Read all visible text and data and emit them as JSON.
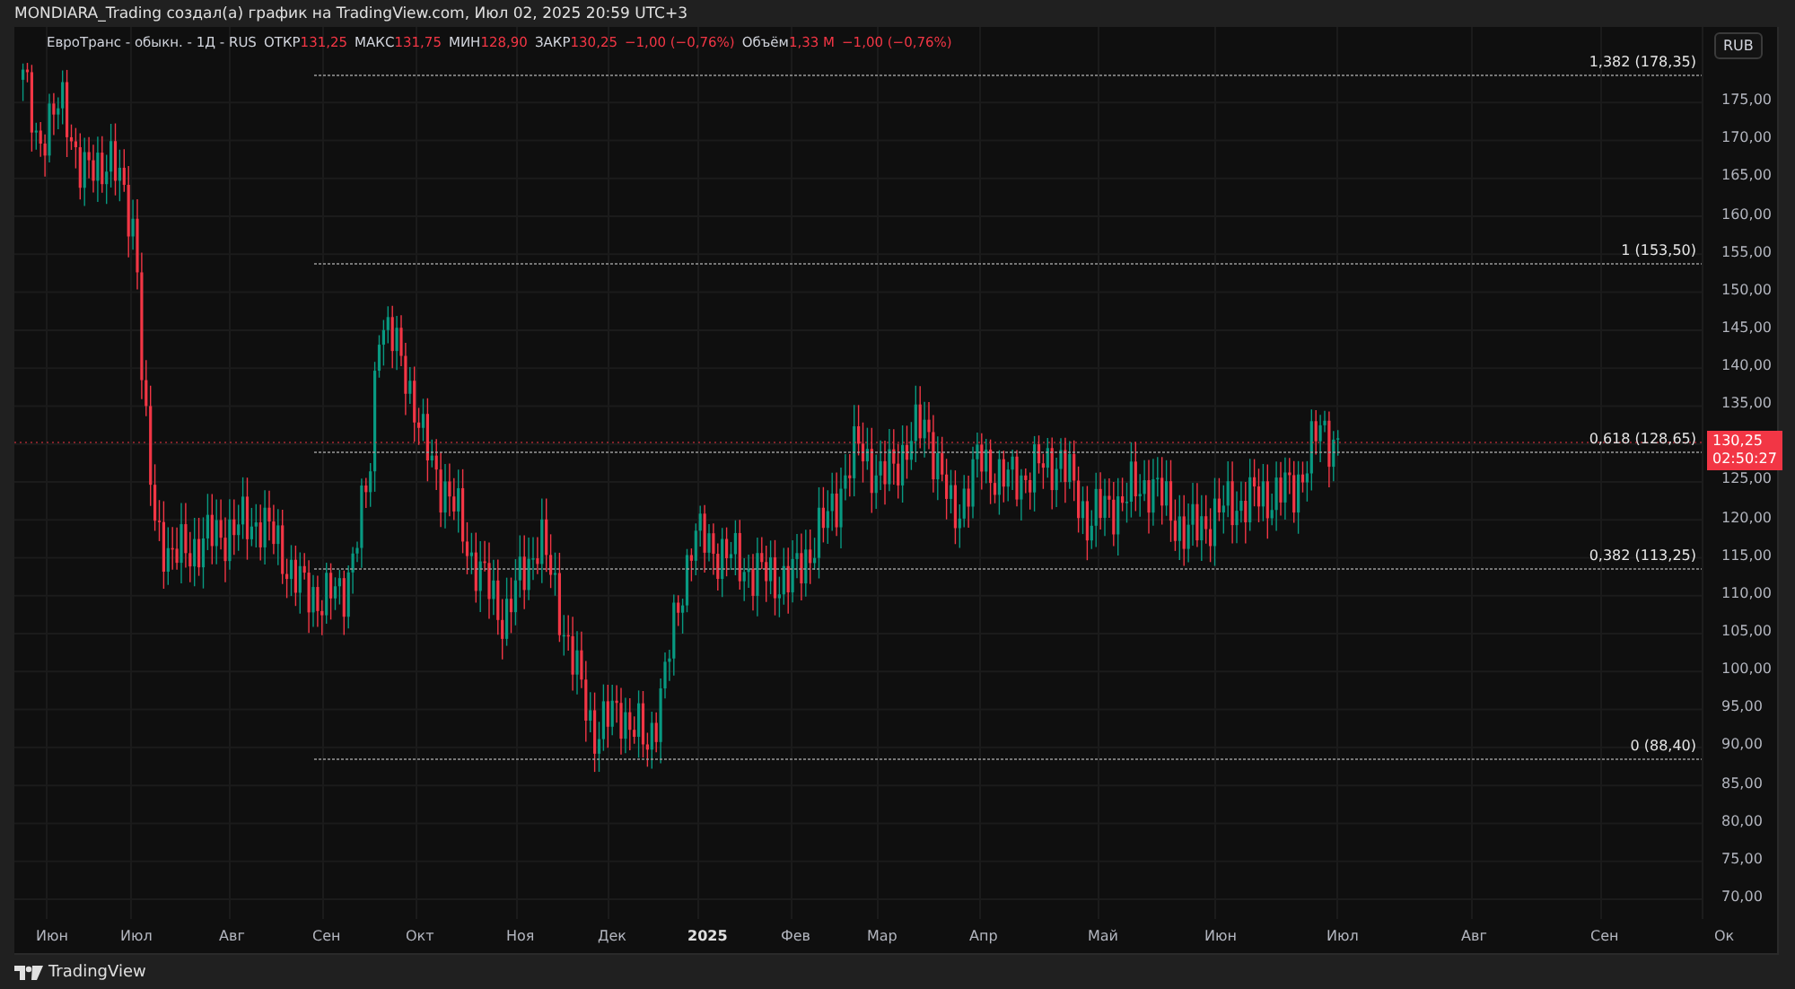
{
  "header": {
    "title": "MONDIARA_Trading создал(а) график на TradingView.com, Июл 02, 2025 20:59 UTC+3"
  },
  "legend": {
    "symbol": "ЕвроТранс - обыкн. - 1Д - RUS",
    "fields": [
      {
        "label": "ОТКР",
        "value": "131,25"
      },
      {
        "label": "МАКС",
        "value": "131,75"
      },
      {
        "label": "МИН",
        "value": "128,90"
      },
      {
        "label": "ЗАКР",
        "value": "130,25"
      }
    ],
    "change": "−1,00 (−0,76%)",
    "volume": {
      "label": "Объём",
      "value": "1,33 M",
      "change": "−1,00 (−0,76%)"
    }
  },
  "currency": "RUB",
  "fib_levels": [
    {
      "label": "1,382 (178,35)"
    },
    {
      "label": "1 (153,50)"
    },
    {
      "label": "0,618 (128,65)"
    },
    {
      "label": "0,382 (113,25)"
    },
    {
      "label": "0 (88,40)"
    }
  ],
  "last_price": {
    "price": "130,25",
    "countdown": "02:50:27"
  },
  "price_axis": {
    "labels": [
      "175,00",
      "170,00",
      "165,00",
      "160,00",
      "155,00",
      "150,00",
      "145,00",
      "140,00",
      "135,00",
      "125,00",
      "120,00",
      "115,00",
      "110,00",
      "105,00",
      "100,00",
      "95,00",
      "90,00",
      "85,00",
      "80,00",
      "75,00",
      "70,00"
    ]
  },
  "time_axis": {
    "labels": [
      "Июн",
      "Июл",
      "Авг",
      "Сен",
      "Окт",
      "Ноя",
      "Дек",
      "2025",
      "Фев",
      "Мар",
      "Апр",
      "Май",
      "Июн",
      "Июл",
      "Авг",
      "Сен",
      "Ок"
    ]
  },
  "footer": {
    "brand": "TradingView"
  }
}
